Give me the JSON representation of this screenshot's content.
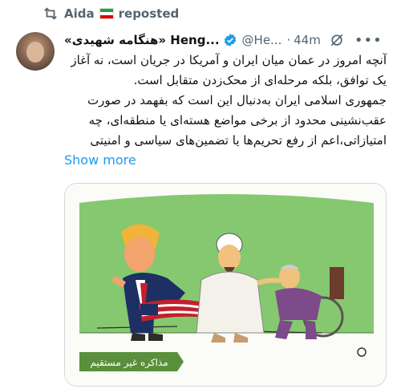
{
  "repost": {
    "user": "Aida",
    "action": "reposted"
  },
  "author": {
    "name": "«هنگامه شهیدی» Heng...",
    "handle": "@He...",
    "time": "44m"
  },
  "post_text": [
    "آنچه امروز در عمان میان ایران و آمریکا در جریان است، نه آغاز",
    "یک توافق، بلکه مرحله‌ای از محک‌زدن متقابل است.",
    "جمهوری اسلامی ایران به‌دنبال این است که بفهمد در صورت",
    "عقب‌نشینی محدود از برخی مواضع هسته‌ای یا منطقه‌ای، چه",
    "امتیازاتی،اعم از رفع تحریم‌ها یا تضمین‌های سیاسی و امنیتی"
  ],
  "show_more": "Show more",
  "cartoon": {
    "caption": "مذاکره غیر مستقیم"
  },
  "colors": {
    "accent": "#1d9bf0",
    "secondary": "#536471",
    "border": "#cfd9de",
    "cartoon_bg": "#86c86f"
  },
  "icons": [
    "repost-icon",
    "iran-flag-icon",
    "verified-icon",
    "grok-icon",
    "more-icon"
  ]
}
